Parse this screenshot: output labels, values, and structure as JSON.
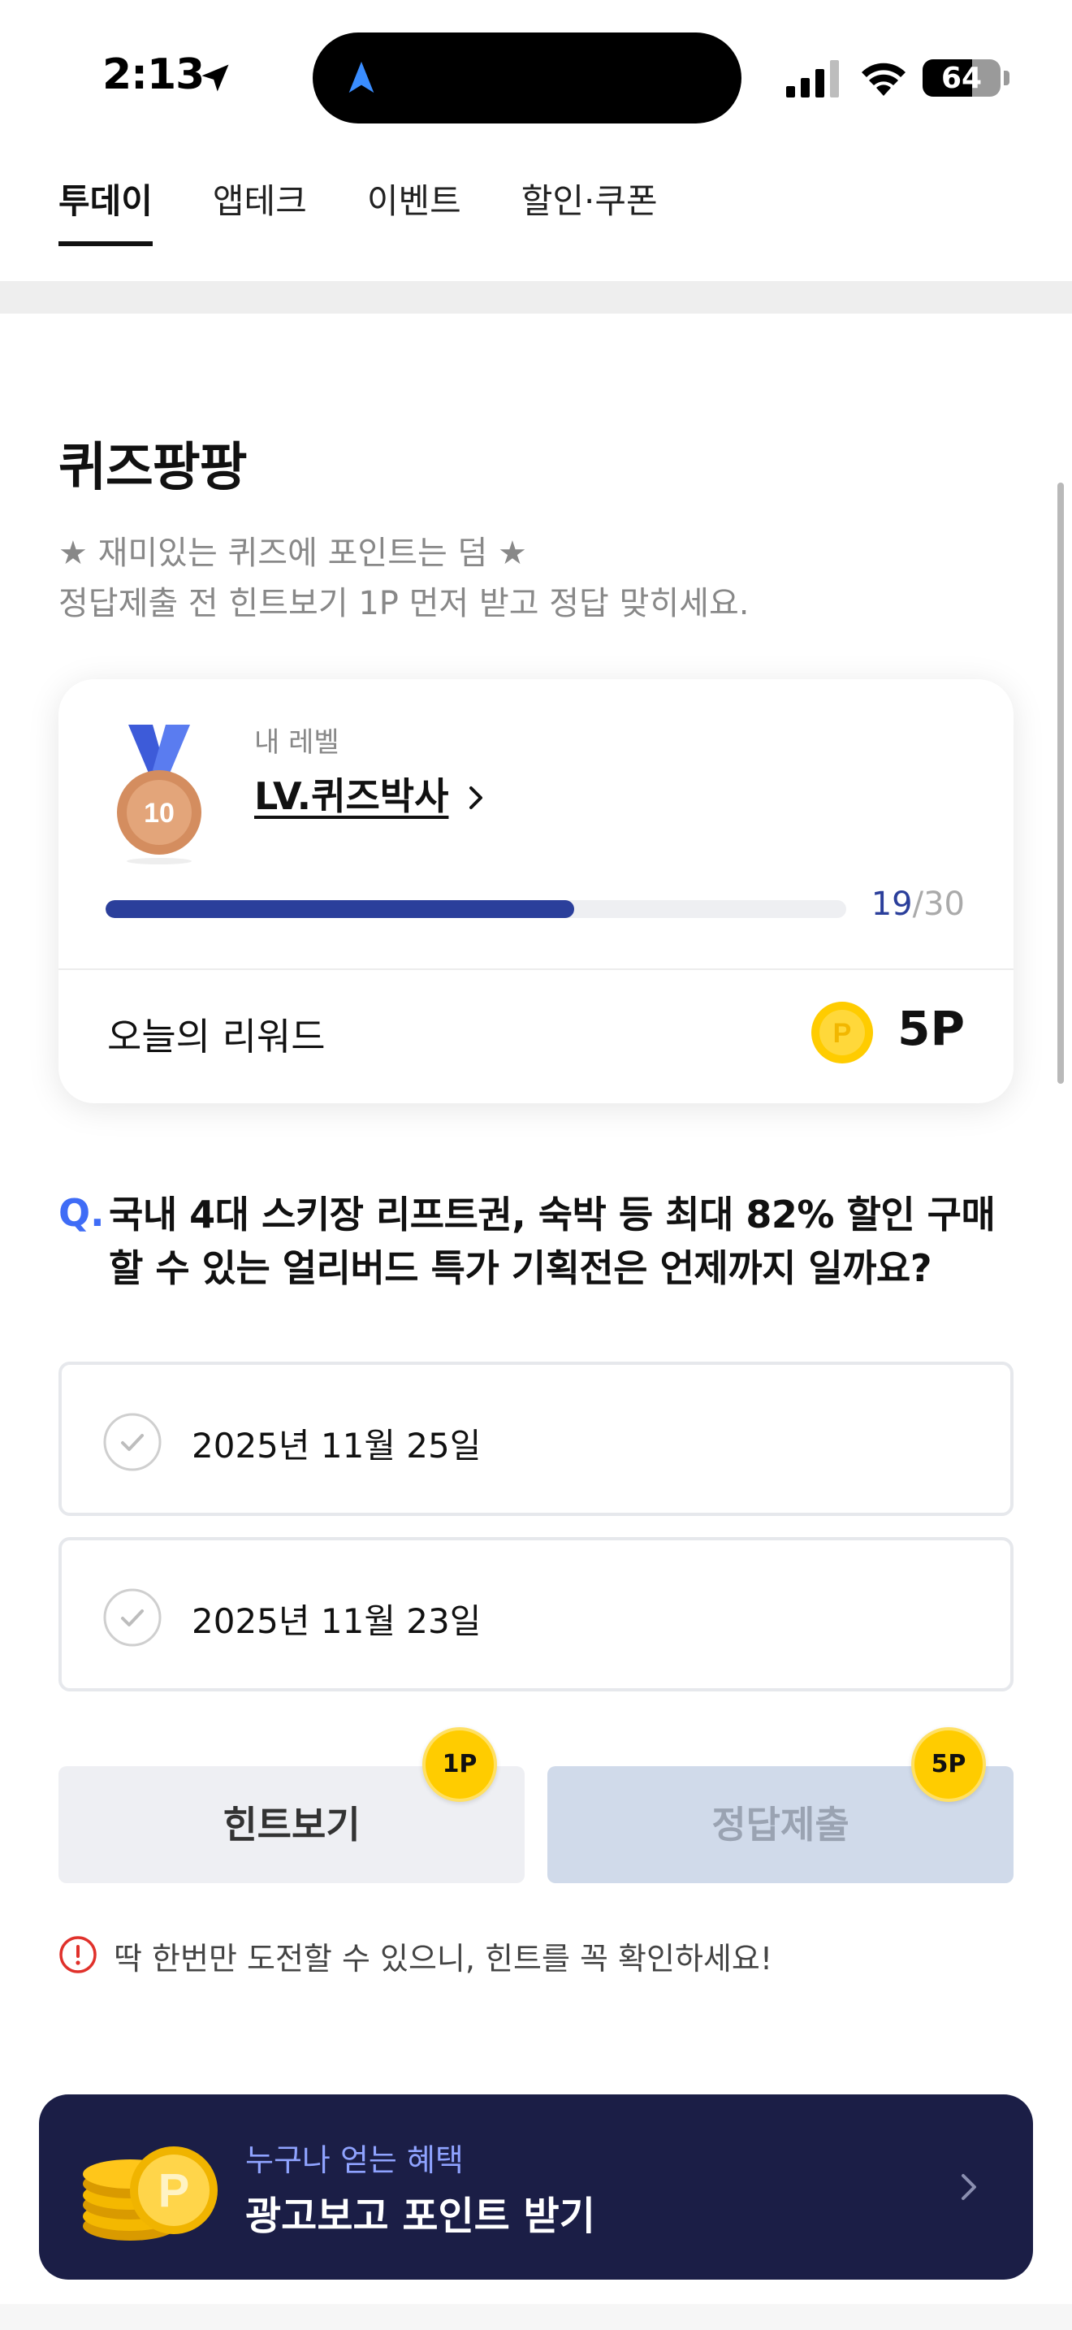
{
  "status_bar": {
    "time": "2:13",
    "battery": "64"
  },
  "tabs": [
    {
      "label": "투데이",
      "active": true
    },
    {
      "label": "앱테크",
      "active": false
    },
    {
      "label": "이벤트",
      "active": false
    },
    {
      "label": "할인·쿠폰",
      "active": false
    }
  ],
  "quiz": {
    "title": "퀴즈팡팡",
    "desc_line1": "★ 재미있는 퀴즈에 포인트는 덤 ★",
    "desc_line2": "정답제출 전 힌트보기 1P 먼저 받고 정답 맞히세요."
  },
  "level_card": {
    "medal_number": "10",
    "label": "내 레벨",
    "name": "LV.퀴즈박사",
    "progress_current": "19",
    "progress_total": "/30",
    "progress_fraction": 0.633,
    "reward_label": "오늘의 리워드",
    "reward_value": "5P"
  },
  "question": {
    "mark": "Q.",
    "text": "국내 4대 스키장 리프트권, 숙박 등 최대 82% 할인 구매할 수 있는 얼리버드 특가 기획전은 언제까지 일까요?"
  },
  "options": [
    {
      "label": "2025년 11월 25일"
    },
    {
      "label": "2025년 11월 23일"
    }
  ],
  "buttons": {
    "hint_label": "힌트보기",
    "hint_badge": "1P",
    "submit_label": "정답제출",
    "submit_badge": "5P"
  },
  "warning": "딱 한번만 도전할 수 있으니, 힌트를 꼭 확인하세요!",
  "banner": {
    "subtitle": "누구나 얻는 혜택",
    "title": "광고보고 포인트 받기"
  },
  "colors": {
    "accent_navy": "#2b3f9b",
    "question_blue": "#3f6cf6",
    "coin_yellow": "#ffcc00",
    "banner_bg": "#1b1e46"
  }
}
